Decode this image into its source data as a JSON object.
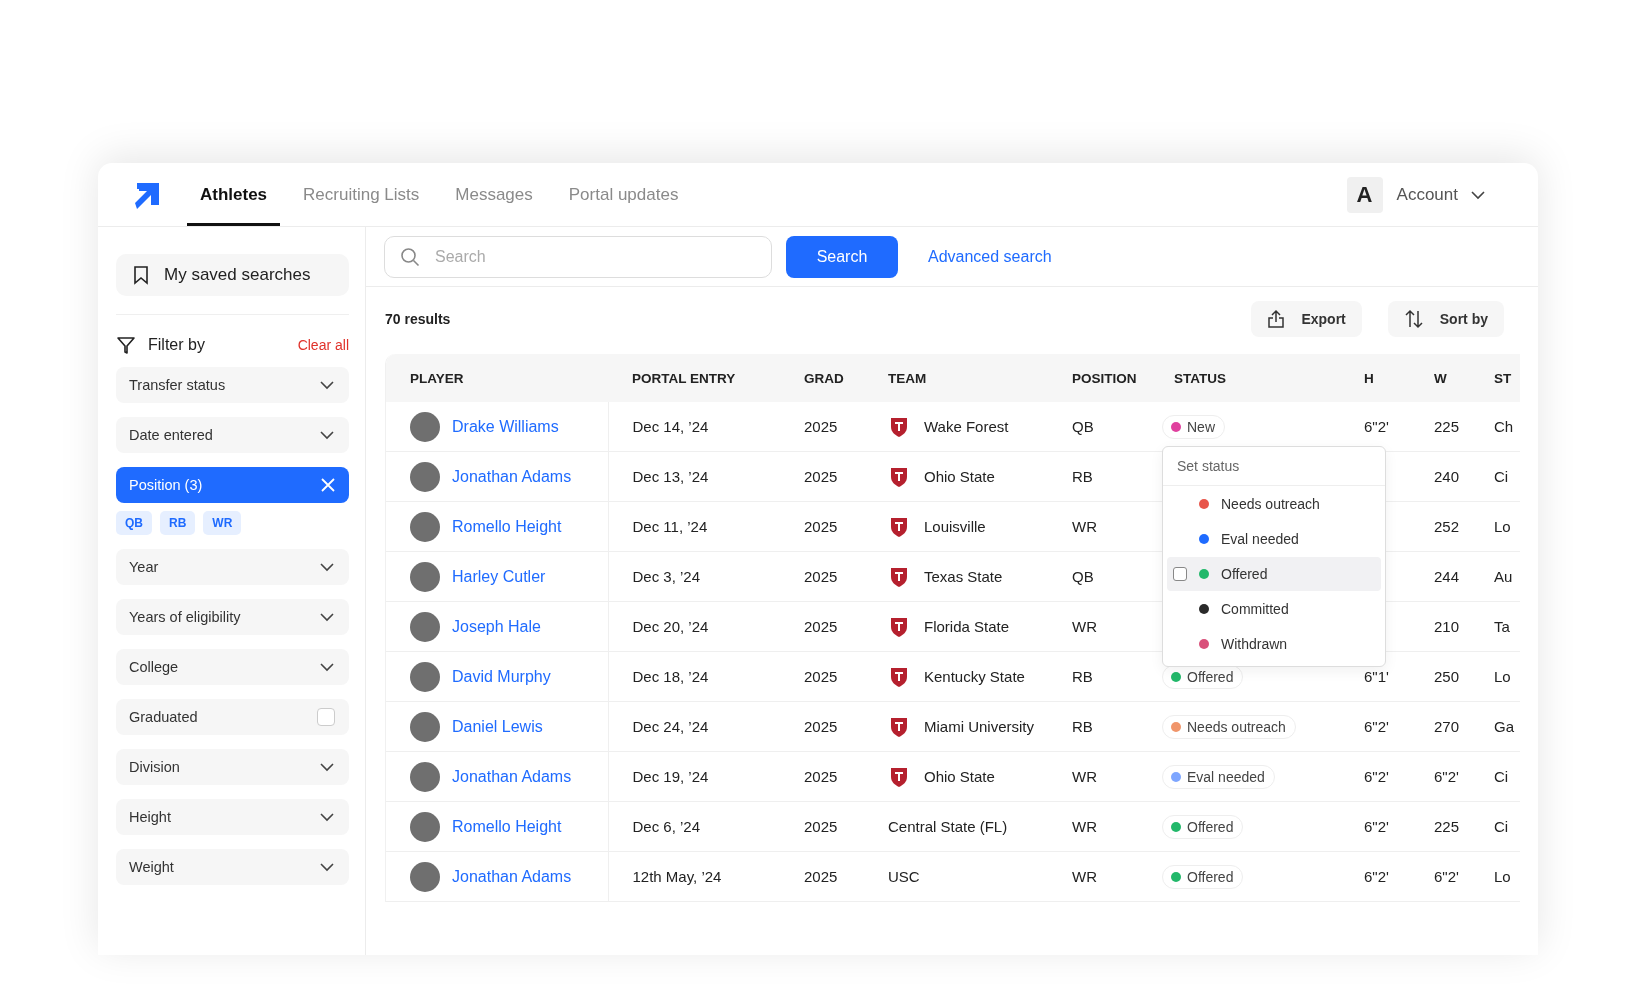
{
  "nav": {
    "tabs": [
      {
        "label": "Athletes",
        "selected": true
      },
      {
        "label": "Recruiting Lists",
        "selected": false
      },
      {
        "label": "Messages",
        "selected": false
      },
      {
        "label": "Portal updates",
        "selected": false
      }
    ],
    "account": {
      "initial": "A",
      "label": "Account"
    }
  },
  "sidebar": {
    "saved_searches": "My saved searches",
    "filter_title": "Filter by",
    "clear_all": "Clear all",
    "filters": [
      {
        "kind": "dropdown",
        "label": "Transfer status"
      },
      {
        "kind": "dropdown",
        "label": "Date entered"
      },
      {
        "kind": "active",
        "label": "Position (3)",
        "chips": [
          "QB",
          "RB",
          "WR"
        ]
      },
      {
        "kind": "dropdown",
        "label": "Year"
      },
      {
        "kind": "dropdown",
        "label": "Years of eligibility"
      },
      {
        "kind": "dropdown",
        "label": "College"
      },
      {
        "kind": "checkbox",
        "label": "Graduated",
        "checked": false
      },
      {
        "kind": "dropdown",
        "label": "Division"
      },
      {
        "kind": "dropdown",
        "label": "Height"
      },
      {
        "kind": "dropdown",
        "label": "Weight"
      }
    ]
  },
  "search": {
    "placeholder": "Search",
    "button": "Search",
    "advanced": "Advanced search"
  },
  "results": {
    "count": "70 results",
    "export": "Export",
    "sort": "Sort by"
  },
  "table": {
    "columns": [
      "PLAYER",
      "PORTAL ENTRY",
      "GRAD",
      "TEAM",
      "POSITION",
      "STATUS",
      "H",
      "W",
      "ST"
    ],
    "rows": [
      {
        "player": "Drake Williams",
        "portal_entry": "Dec 14, ’24",
        "grad": "2025",
        "team": "Wake Forest",
        "logo": true,
        "position": "QB",
        "status": {
          "label": "New",
          "color": "#e0409e"
        },
        "h": "6\"2'",
        "w": "225",
        "st": "Ch"
      },
      {
        "player": "Jonathan Adams",
        "portal_entry": "Dec 13, ’24",
        "grad": "2025",
        "team": "Ohio State",
        "logo": true,
        "position": "RB",
        "w": "240",
        "st": "Ci"
      },
      {
        "player": "Romello Height",
        "portal_entry": "Dec 11, ’24",
        "grad": "2025",
        "team": "Louisville",
        "logo": true,
        "position": "WR",
        "w": "252",
        "st": "Lo"
      },
      {
        "player": "Harley Cutler",
        "portal_entry": "Dec 3, ’24",
        "grad": "2025",
        "team": "Texas State",
        "logo": true,
        "position": "QB",
        "w": "244",
        "st": "Au"
      },
      {
        "player": "Joseph Hale",
        "portal_entry": "Dec 20, ’24",
        "grad": "2025",
        "team": "Florida State",
        "logo": true,
        "position": "WR",
        "w": "210",
        "st": "Ta"
      },
      {
        "player": "David Murphy",
        "portal_entry": "Dec 18, ’24",
        "grad": "2025",
        "team": "Kentucky State",
        "logo": true,
        "position": "RB",
        "status": {
          "label": "Offered",
          "color": "#22b86a"
        },
        "h": "6\"1'",
        "w": "250",
        "st": "Lo"
      },
      {
        "player": "Daniel Lewis",
        "portal_entry": "Dec 24, ’24",
        "grad": "2025",
        "team": "Miami University",
        "logo": true,
        "position": "RB",
        "status": {
          "label": "Needs outreach",
          "color": "#f0956a"
        },
        "h": "6\"2'",
        "w": "270",
        "st": "Ga"
      },
      {
        "player": "Jonathan Adams",
        "portal_entry": "Dec 19, ’24",
        "grad": "2025",
        "team": "Ohio State",
        "logo": true,
        "position": "WR",
        "status": {
          "label": "Eval needed",
          "color": "#7ea6ff"
        },
        "h": "6\"2'",
        "w": "6\"2'",
        "st": "Ci"
      },
      {
        "player": "Romello Height",
        "portal_entry": "Dec 6, ’24",
        "grad": "2025",
        "team": "Central State (FL)",
        "logo": false,
        "position": "WR",
        "status": {
          "label": "Offered",
          "color": "#22b86a"
        },
        "h": "6\"2'",
        "w": "225",
        "st": "Ci"
      },
      {
        "player": "Jonathan Adams",
        "portal_entry": "12th May, ’24",
        "grad": "2025",
        "team": "USC",
        "logo": false,
        "position": "WR",
        "status": {
          "label": "Offered",
          "color": "#22b86a"
        },
        "h": "6\"2'",
        "w": "6\"2'",
        "st": "Lo"
      }
    ]
  },
  "status_menu": {
    "title": "Set status",
    "items": [
      {
        "label": "Needs outreach",
        "color": "#e8554a",
        "selected": false
      },
      {
        "label": "Eval needed",
        "color": "#1f6bff",
        "selected": false
      },
      {
        "label": "Offered",
        "color": "#22b86a",
        "selected": true
      },
      {
        "label": "Committed",
        "color": "#2a2a2a",
        "selected": false
      },
      {
        "label": "Withdrawn",
        "color": "#d9507a",
        "selected": false
      }
    ]
  }
}
